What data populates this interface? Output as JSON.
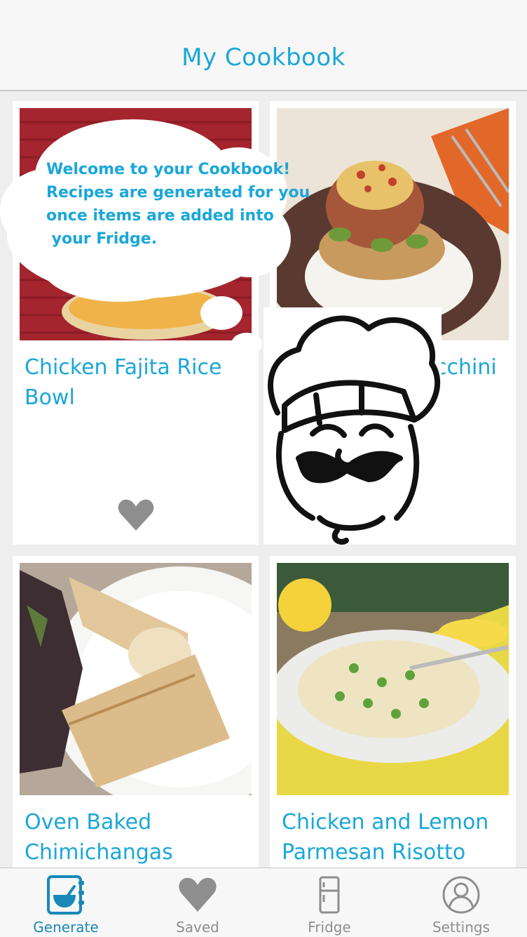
{
  "header": {
    "title": "My Cookbook"
  },
  "onboarding": {
    "lines": [
      "Welcome to your Cookbook!",
      "Recipes are generated for you",
      "once items are added into",
      " your Fridge."
    ]
  },
  "recipes": [
    {
      "title_line1": "Chicken Fajita Rice",
      "title_line2": "Bowl"
    },
    {
      "title_line1": "cchini",
      "title_line2": ""
    },
    {
      "title_line1": "Oven Baked",
      "title_line2": "Chimichangas"
    },
    {
      "title_line1": "Chicken and Lemon",
      "title_line2": "Parmesan Risotto"
    }
  ],
  "tabs": [
    {
      "label": "Generate",
      "icon": "cookbook-icon"
    },
    {
      "label": "Saved",
      "icon": "heart-icon"
    },
    {
      "label": "Fridge",
      "icon": "fridge-icon"
    },
    {
      "label": "Settings",
      "icon": "person-icon"
    }
  ],
  "colors": {
    "accent": "#1aa7d8",
    "tab_active": "#1a88b8",
    "tab_inactive": "#8e8e8e"
  }
}
